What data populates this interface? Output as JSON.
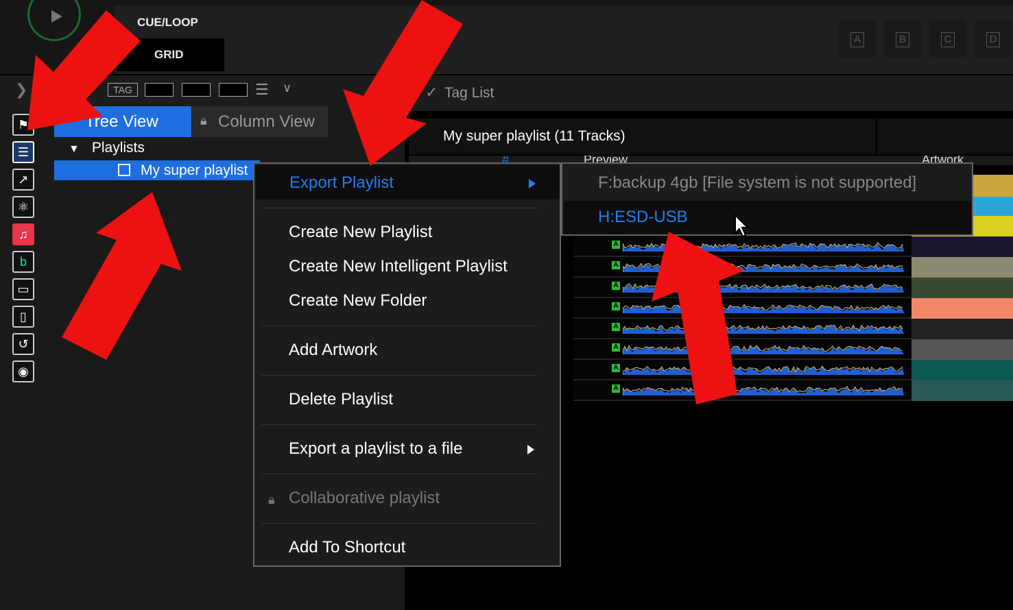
{
  "deck": {
    "cue_loop_label": "CUE/LOOP",
    "grid_label": "GRID",
    "hotcues": [
      "A",
      "B",
      "C",
      "D"
    ]
  },
  "browser": {
    "tag_label": "TAG",
    "tag_list_label": "Tag List",
    "tabs": {
      "tree_view": "Tree View",
      "column_view": "Column View"
    },
    "tree": {
      "playlists_label": "Playlists",
      "selected_playlist": "My super playlist"
    },
    "sidebar_icons": [
      "bookmark-icon",
      "playlist-icon",
      "link-icon",
      "atom-icon",
      "music-app-icon",
      "beatport-icon",
      "laptop-icon",
      "phone-icon",
      "history-icon",
      "record-icon"
    ]
  },
  "track_list": {
    "title": "My super playlist (11 Tracks)",
    "columns": [
      "#",
      "Preview",
      "Artwork"
    ],
    "track_badges": [
      "A",
      "A",
      "A",
      "A",
      "A",
      "A",
      "A",
      "A"
    ]
  },
  "context_menu": {
    "items": {
      "export_playlist": "Export Playlist",
      "create_new_playlist": "Create New Playlist",
      "create_new_intelligent_playlist": "Create New Intelligent Playlist",
      "create_new_folder": "Create New Folder",
      "add_artwork": "Add Artwork",
      "delete_playlist": "Delete Playlist",
      "export_to_file": "Export a playlist to a file",
      "collaborative_playlist": "Collaborative playlist",
      "add_to_shortcut": "Add To Shortcut"
    }
  },
  "export_submenu": {
    "drive_f": "F:backup 4gb [File system is not supported]",
    "drive_h": "H:ESD-USB"
  },
  "colors": {
    "accent_blue": "#1f6fe0",
    "menu_highlight_text": "#1f7ff0",
    "arrow_red": "#ee1111"
  }
}
